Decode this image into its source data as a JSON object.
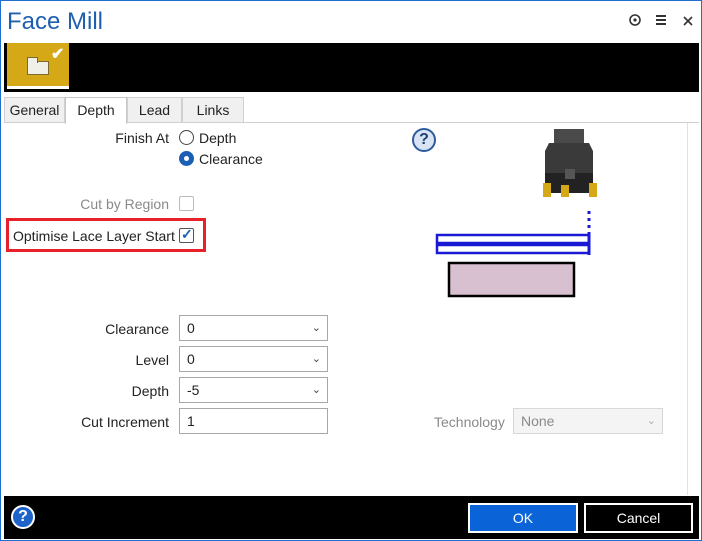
{
  "window": {
    "title": "Face Mill",
    "icons": [
      "pin-icon",
      "menu-icon",
      "close-icon"
    ]
  },
  "ribbon": {
    "button_icon": "folder-check-icon",
    "accent_color": "#d4a816"
  },
  "tabs": [
    {
      "label": "General",
      "active": false
    },
    {
      "label": "Depth",
      "active": true
    },
    {
      "label": "Lead",
      "active": false
    },
    {
      "label": "Links",
      "active": false
    }
  ],
  "form": {
    "finish_at": {
      "label": "Finish At",
      "options": [
        {
          "label": "Depth",
          "selected": false
        },
        {
          "label": "Clearance",
          "selected": true
        }
      ]
    },
    "cut_by_region": {
      "label": "Cut by Region",
      "checked": false,
      "enabled": false
    },
    "optimise_lace": {
      "label": "Optimise Lace Layer Start",
      "checked": true,
      "enabled": true
    },
    "clearance": {
      "label": "Clearance",
      "value": "0"
    },
    "level": {
      "label": "Level",
      "value": "0"
    },
    "depth": {
      "label": "Depth",
      "value": "-5"
    },
    "cut_increment": {
      "label": "Cut Increment",
      "value": "1"
    },
    "technology": {
      "label": "Technology",
      "value": "None",
      "enabled": false
    }
  },
  "footer": {
    "ok_label": "OK",
    "cancel_label": "Cancel",
    "ok_color": "#0a64d8"
  },
  "colors": {
    "title": "#1f5faf",
    "highlight": "#e8202a",
    "illustration_line": "#1a1ad6",
    "workpiece": "#d8c0d0"
  }
}
